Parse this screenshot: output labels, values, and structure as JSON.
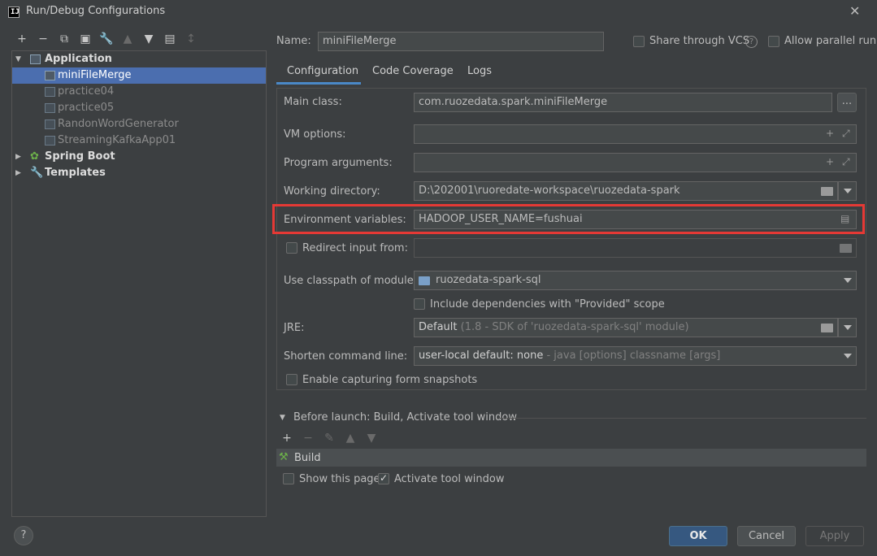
{
  "window": {
    "title": "Run/Debug Configurations",
    "app_icon_text": "IJ"
  },
  "toolbar": {
    "icons": [
      "add-icon",
      "remove-icon",
      "copy-icon",
      "save-icon",
      "wrench-icon",
      "move-up-icon",
      "move-down-icon",
      "new-folder-icon",
      "sort-icon"
    ]
  },
  "tree": {
    "application": "Application",
    "items": [
      "miniFileMerge",
      "practice04",
      "practice05",
      "RandonWordGenerator",
      "StreamingKafkaApp01"
    ],
    "spring_boot": "Spring Boot",
    "templates": "Templates"
  },
  "header": {
    "name_label": "Name:",
    "name_value": "miniFileMerge",
    "share_vcs": "Share through VCS",
    "allow_parallel": "Allow parallel run"
  },
  "tabs": [
    "Configuration",
    "Code Coverage",
    "Logs"
  ],
  "form": {
    "main_class_label": "Main class:",
    "main_class_value": "com.ruozedata.spark.miniFileMerge",
    "browse": "...",
    "vm_options_label": "VM options:",
    "program_args_label": "Program arguments:",
    "working_dir_label": "Working directory:",
    "working_dir_value": "D:\\202001\\ruoredate-workspace\\ruozedata-spark",
    "env_vars_label": "Environment variables:",
    "env_vars_value": "HADOOP_USER_NAME=fushuai",
    "redirect_label": "Redirect input from:",
    "classpath_label": "Use classpath of module:",
    "classpath_value": "ruozedata-spark-sql",
    "include_deps": "Include dependencies with \"Provided\" scope",
    "jre_label": "JRE:",
    "jre_value": "Default",
    "jre_hint": "(1.8 - SDK of 'ruozedata-spark-sql' module)",
    "shorten_label": "Shorten command line:",
    "shorten_value": "user-local default: none",
    "shorten_hint": "- java [options] classname [args]",
    "enable_snapshots": "Enable capturing form snapshots"
  },
  "before_launch": {
    "title": "Before launch: Build, Activate tool window",
    "task": "Build",
    "show_page": "Show this page",
    "activate_tool": "Activate tool window"
  },
  "footer": {
    "help": "?",
    "ok": "OK",
    "cancel": "Cancel",
    "apply": "Apply"
  }
}
